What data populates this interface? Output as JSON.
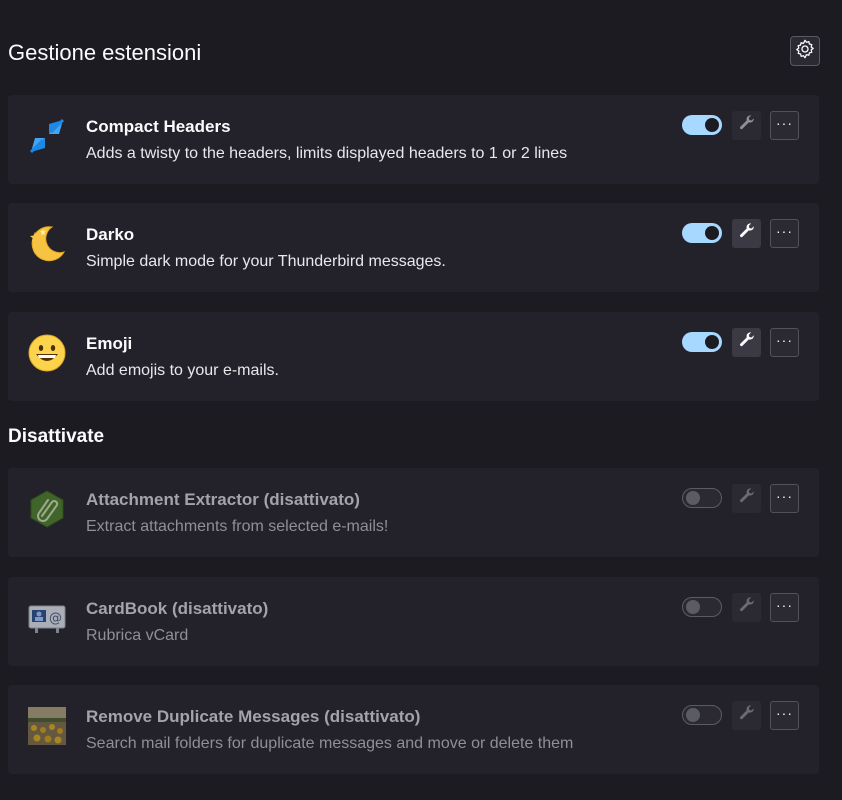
{
  "header": {
    "title": "Gestione estensioni",
    "settings_icon": "gear-icon"
  },
  "enabled_extensions": [
    {
      "name": "Compact Headers",
      "description": "Adds a twisty to the headers, limits displayed headers to 1 or 2 lines",
      "icon": "compact-arrows-icon",
      "enabled": true,
      "has_preferences": false
    },
    {
      "name": "Darko",
      "description": "Simple dark mode for your Thunderbird messages.",
      "icon": "moon-stars-icon",
      "enabled": true,
      "has_preferences": true
    },
    {
      "name": "Emoji",
      "description": "Add emojis to your e-mails.",
      "icon": "smiley-icon",
      "enabled": true,
      "has_preferences": true
    }
  ],
  "disabled_section": {
    "title": "Disattivate"
  },
  "disabled_extensions": [
    {
      "name": "Attachment Extractor (disattivato)",
      "description": "Extract attachments from selected e-mails!",
      "icon": "paperclip-hexagon-icon",
      "enabled": false
    },
    {
      "name": "CardBook (disattivato)",
      "description": "Rubrica vCard",
      "icon": "address-card-icon",
      "enabled": false
    },
    {
      "name": "Remove Duplicate Messages (disattivato)",
      "description": "Search mail folders for duplicate messages and move or delete them",
      "icon": "sunflower-field-icon",
      "enabled": false
    }
  ],
  "controls": {
    "more_label": "···",
    "preferences_icon": "wrench-icon",
    "toggle_icon": "toggle-switch"
  },
  "colors": {
    "background": "#1c1b22",
    "card": "#23222b",
    "toggle_on": "#a7d8ff",
    "text": "#fbfbfe",
    "muted_text": "#8f8f96"
  }
}
